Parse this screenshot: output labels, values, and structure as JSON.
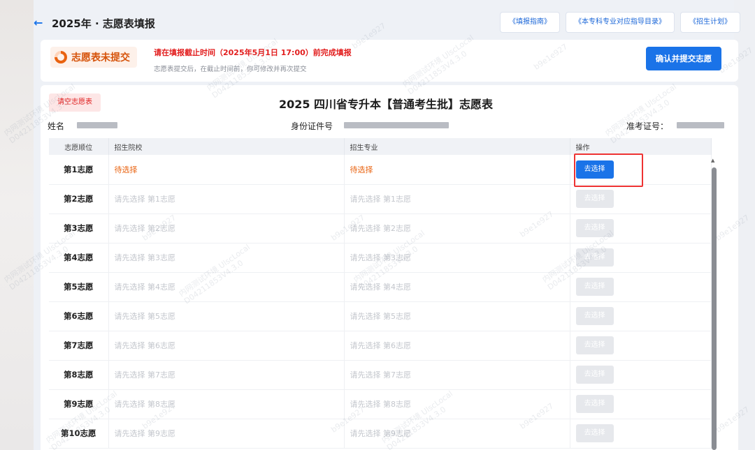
{
  "header": {
    "title": "2025年 · 志愿表填报",
    "links": [
      "《填报指南》",
      "《本专科专业对应指导目录》",
      "《招生计划》"
    ]
  },
  "status": {
    "badge": "志愿表未提交",
    "deadline": "请在填报截止时间（2025年5月1日 17:00）前完成填报",
    "note": "志愿表提交后，在截止时间前，你可修改并再次提交",
    "confirm_label": "确认并提交志愿"
  },
  "form": {
    "clear_label": "请空志愿表",
    "title": "2025 四川省专升本【普通考生批】志愿表",
    "name_label": "姓名",
    "id_label": "身份证件号",
    "ticket_label": "准考证号："
  },
  "table": {
    "headers": [
      "志愿顺位",
      "招生院校",
      "招生专业",
      "操作"
    ],
    "button_label": "去选择",
    "rows": [
      {
        "rank": "第1志愿",
        "school": "待选择",
        "major": "待选择"
      },
      {
        "rank": "第2志愿",
        "school": "请先选择 第1志愿",
        "major": "请先选择 第1志愿"
      },
      {
        "rank": "第3志愿",
        "school": "请先选择 第2志愿",
        "major": "请先选择 第2志愿"
      },
      {
        "rank": "第4志愿",
        "school": "请先选择 第3志愿",
        "major": "请先选择 第3志愿"
      },
      {
        "rank": "第5志愿",
        "school": "请先选择 第4志愿",
        "major": "请先选择 第4志愿"
      },
      {
        "rank": "第6志愿",
        "school": "请先选择 第5志愿",
        "major": "请先选择 第5志愿"
      },
      {
        "rank": "第7志愿",
        "school": "请先选择 第6志愿",
        "major": "请先选择 第6志愿"
      },
      {
        "rank": "第8志愿",
        "school": "请先选择 第7志愿",
        "major": "请先选择 第7志愿"
      },
      {
        "rank": "第9志愿",
        "school": "请先选择 第8志愿",
        "major": "请先选择 第8志愿"
      },
      {
        "rank": "第10志愿",
        "school": "请先选择 第9志愿",
        "major": "请先选择 第9志愿"
      }
    ]
  },
  "watermark": {
    "line1": "内网测试环境 UlscLocal",
    "line2": "D04211853V4.3.0",
    "short": "b9e1e927"
  },
  "colors": {
    "primary": "#1a73e8",
    "pending": "#e9620f",
    "alert": "#e21d1d"
  }
}
